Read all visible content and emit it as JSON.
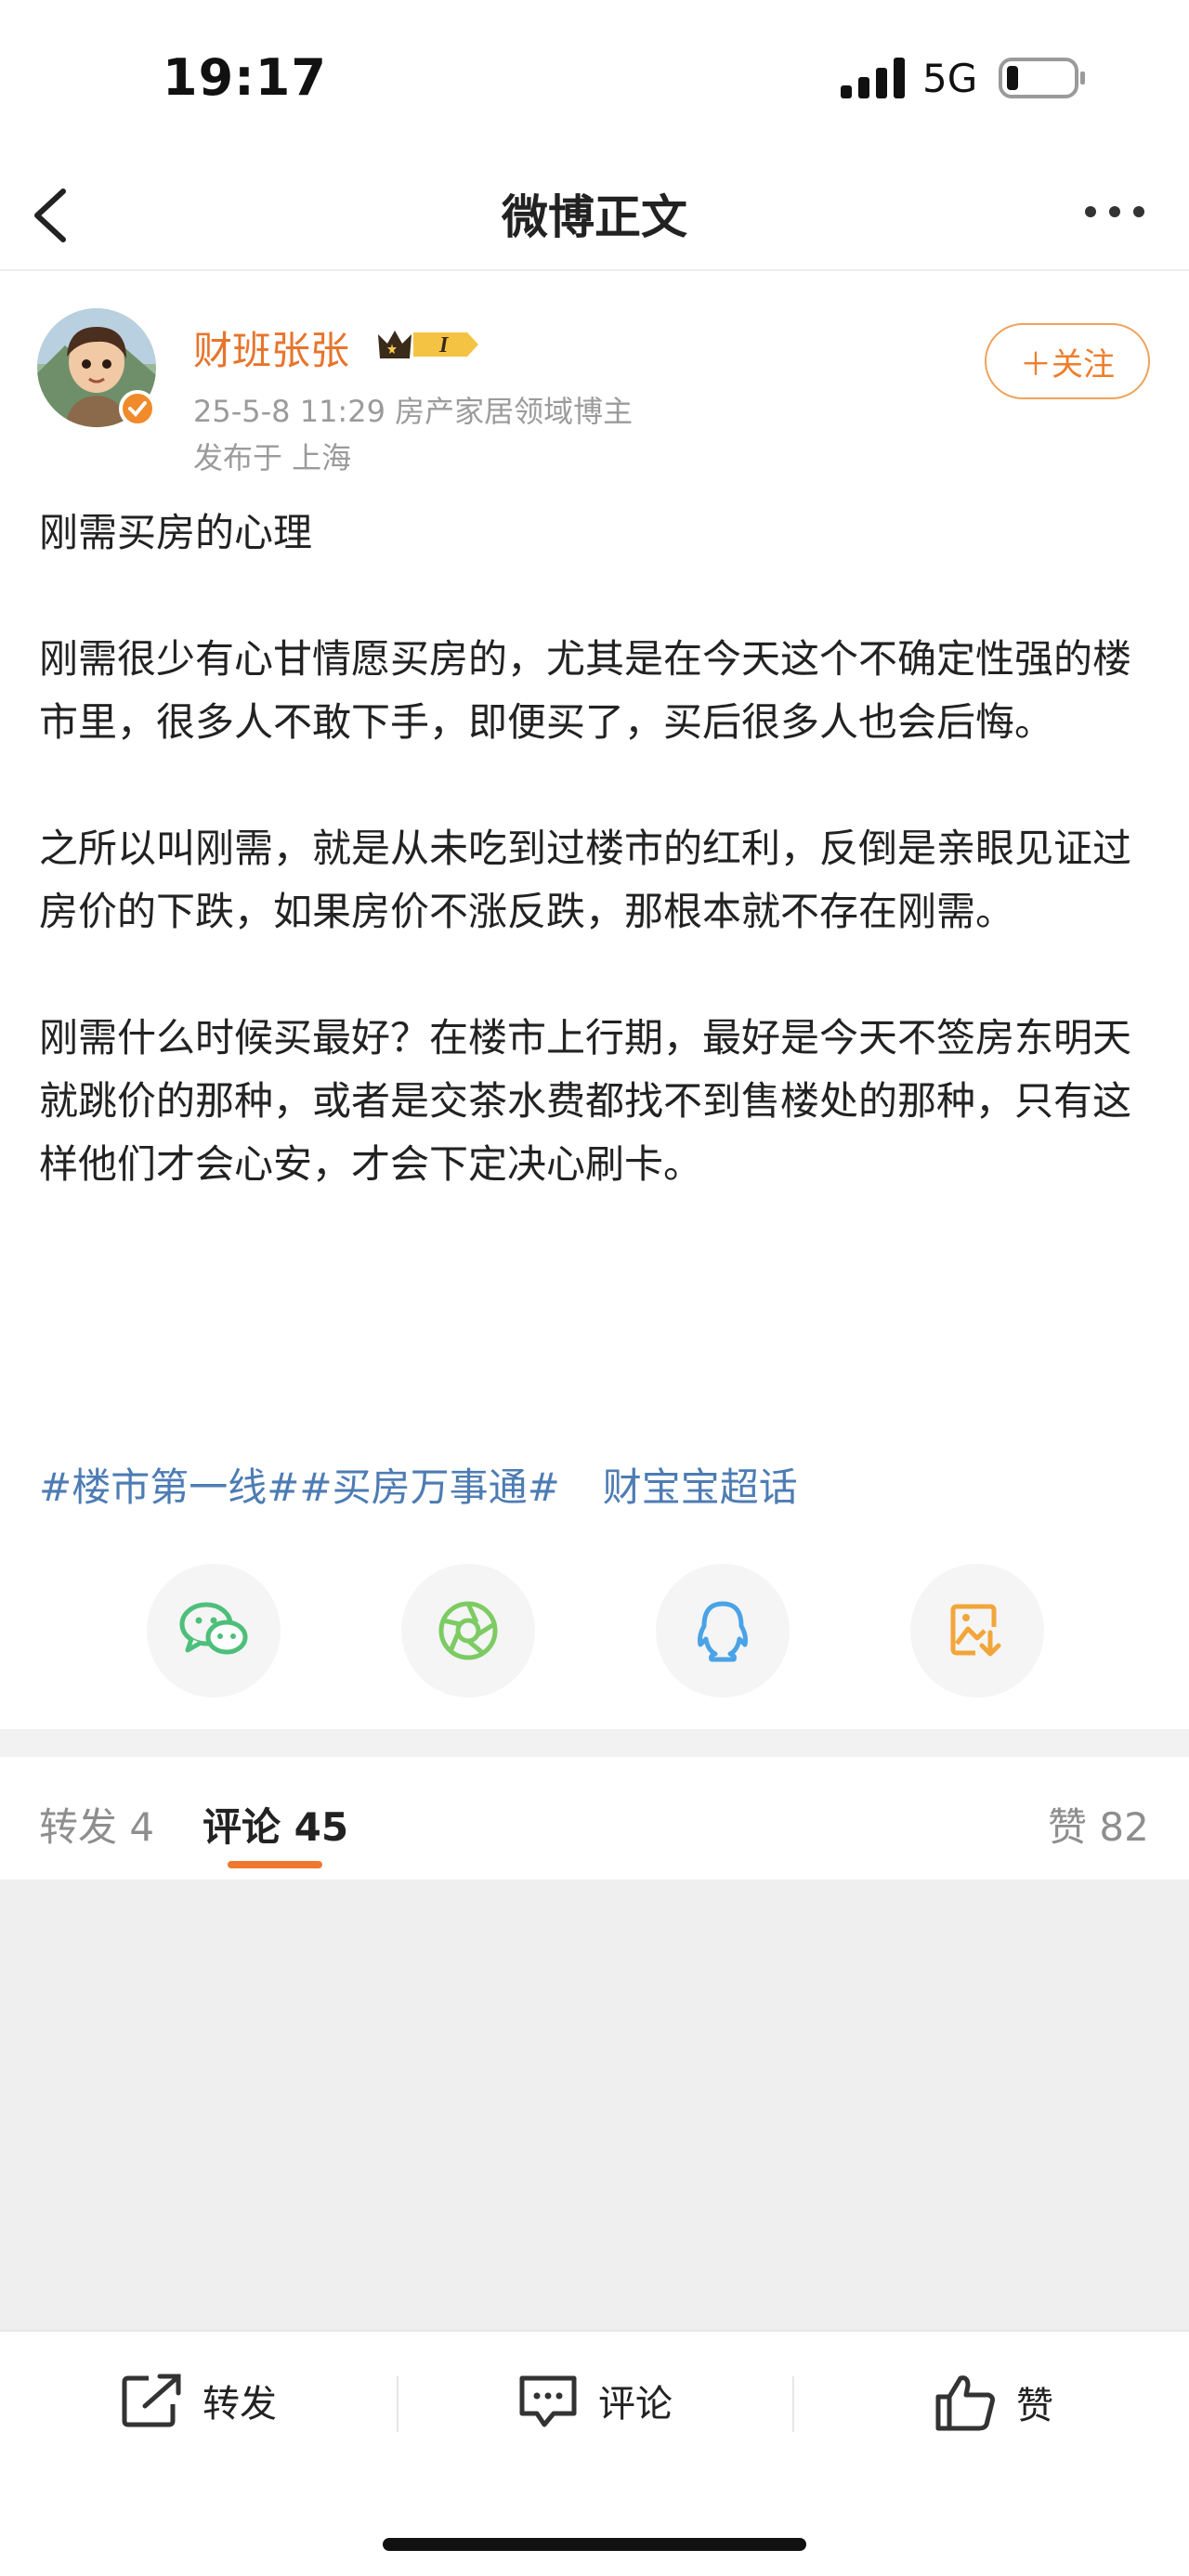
{
  "status_bar": {
    "time": "19:17",
    "network": "5G"
  },
  "nav": {
    "title": "微博正文"
  },
  "author": {
    "name": "财班张张",
    "meta": "25-5-8 11:29  房产家居领域博主",
    "location": "发布于 上海",
    "follow_label": "＋关注",
    "name_color": "#e8742c"
  },
  "post": {
    "paragraphs": [
      "刚需买房的心理",
      "刚需很少有心甘情愿买房的，尤其是在今天这个不确定性强的楼市里，很多人不敢下手，即便买了，买后很多人也会后悔。",
      "之所以叫刚需，就是从未吃到过楼市的红利，反倒是亲眼见证过房价的下跌，如果房价不涨反跌，那根本就不存在刚需。",
      "刚需什么时候买最好？在楼市上行期，最好是今天不签房东明天就跳价的那种，或者是交茶水费都找不到售楼处的那种，只有这样他们才会心安，才会下定决心刷卡。"
    ],
    "topics": [
      "#楼市第一线#",
      "#买房万事通#",
      "财宝宝超话"
    ]
  },
  "share": {
    "icons": [
      "wechat-icon",
      "moments-icon",
      "qq-icon",
      "save-image-icon"
    ]
  },
  "tabs": {
    "repost": "转发 4",
    "comment": "评论 45",
    "like": "赞 82",
    "accent": "#f0782c"
  },
  "bottom_bar": {
    "repost": "转发",
    "comment": "评论",
    "like": "赞"
  }
}
